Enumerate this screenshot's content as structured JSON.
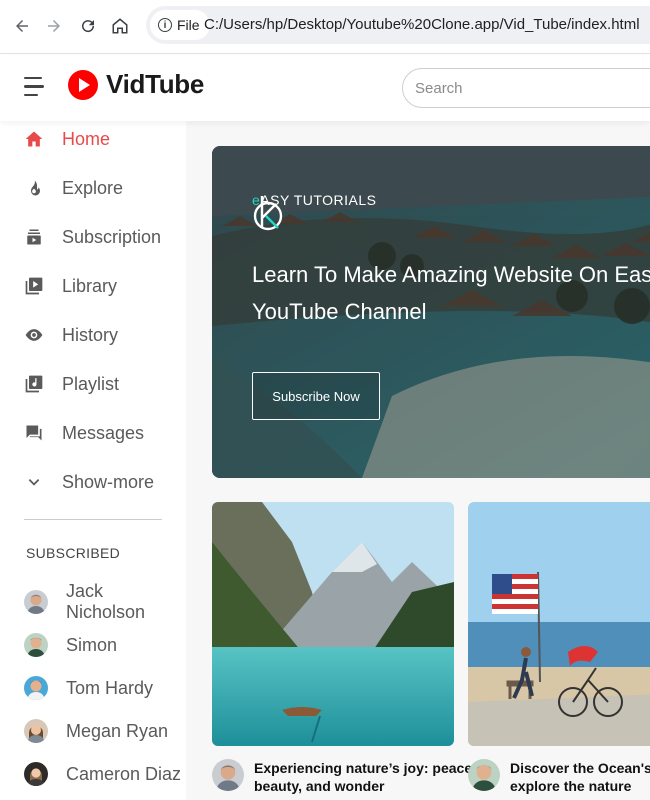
{
  "browser": {
    "site_label": "File",
    "url": "C:/Users/hp/Desktop/Youtube%20Clone.app/Vid_Tube/index.html"
  },
  "header": {
    "logo_text": "VidTube",
    "search_placeholder": "Search"
  },
  "sidebar": {
    "items": [
      {
        "label": "Home",
        "icon": "home-icon",
        "active": true
      },
      {
        "label": "Explore",
        "icon": "flame-icon"
      },
      {
        "label": "Subscription",
        "icon": "subscription-icon"
      },
      {
        "label": "Library",
        "icon": "library-icon"
      },
      {
        "label": "History",
        "icon": "history-icon"
      },
      {
        "label": "Playlist",
        "icon": "playlist-icon"
      },
      {
        "label": "Messages",
        "icon": "messages-icon"
      },
      {
        "label": "Show-more",
        "icon": "chevron-down-icon"
      }
    ],
    "subscribed_title": "SUBSCRIBED",
    "subscribed": [
      {
        "name": "Jack Nicholson"
      },
      {
        "name": "Simon"
      },
      {
        "name": "Tom Hardy"
      },
      {
        "name": "Megan Ryan"
      },
      {
        "name": "Cameron Diaz"
      }
    ]
  },
  "banner": {
    "brand_first": "e",
    "brand_rest": "ASY TUTORIALS",
    "title": "Learn To Make Amazing Website On Easy\nYouTube Channel",
    "button_label": "Subscribe Now"
  },
  "videos": [
    {
      "title_line1": "Experiencing nature’s joy: peace,",
      "title_line2": "beauty, and wonder"
    },
    {
      "title_line1": "Discover the Ocean's Se",
      "title_line2": "explore the nature"
    }
  ],
  "colors": {
    "accent": "#e84a4a",
    "brand_red": "#ff0000",
    "teal": "#21d7c6"
  }
}
